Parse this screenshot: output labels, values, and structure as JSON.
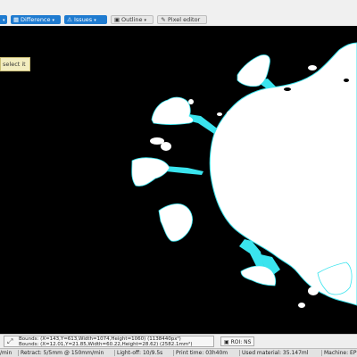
{
  "toolbar": {
    "difference": {
      "label": "Difference",
      "icon": "difference-icon"
    },
    "issues": {
      "label": "Issues",
      "icon": "warning-icon"
    },
    "outline": {
      "label": "Outline",
      "icon": "outline-icon"
    },
    "pixel_editor": {
      "label": "Pixel editor",
      "icon": "pencil-icon"
    },
    "accent_color": "#1f7bd0"
  },
  "tooltip": {
    "text": "select it"
  },
  "viewport": {
    "background": "#000000",
    "part_color": "#ffffff",
    "support_color": "#3ae4ee"
  },
  "bounds": {
    "line1": "Bounds: (X=143,Y=613,Width=1074,Height=1060) (1138440px²)",
    "line2": "Bounds: (X=12.01,Y=21.85,Width=60.22,Height=28.62) (2582.1mm²)",
    "roi_label": "ROI: NS"
  },
  "status": {
    "speed": "/min",
    "retract": "Retract: 5/5mm @ 150mm/min",
    "lightoff": "Light-off: 10/9.5s",
    "print_time": "Print time: 03h40m",
    "material": "Used material: 35.147ml",
    "machine": "Machine: EP"
  }
}
